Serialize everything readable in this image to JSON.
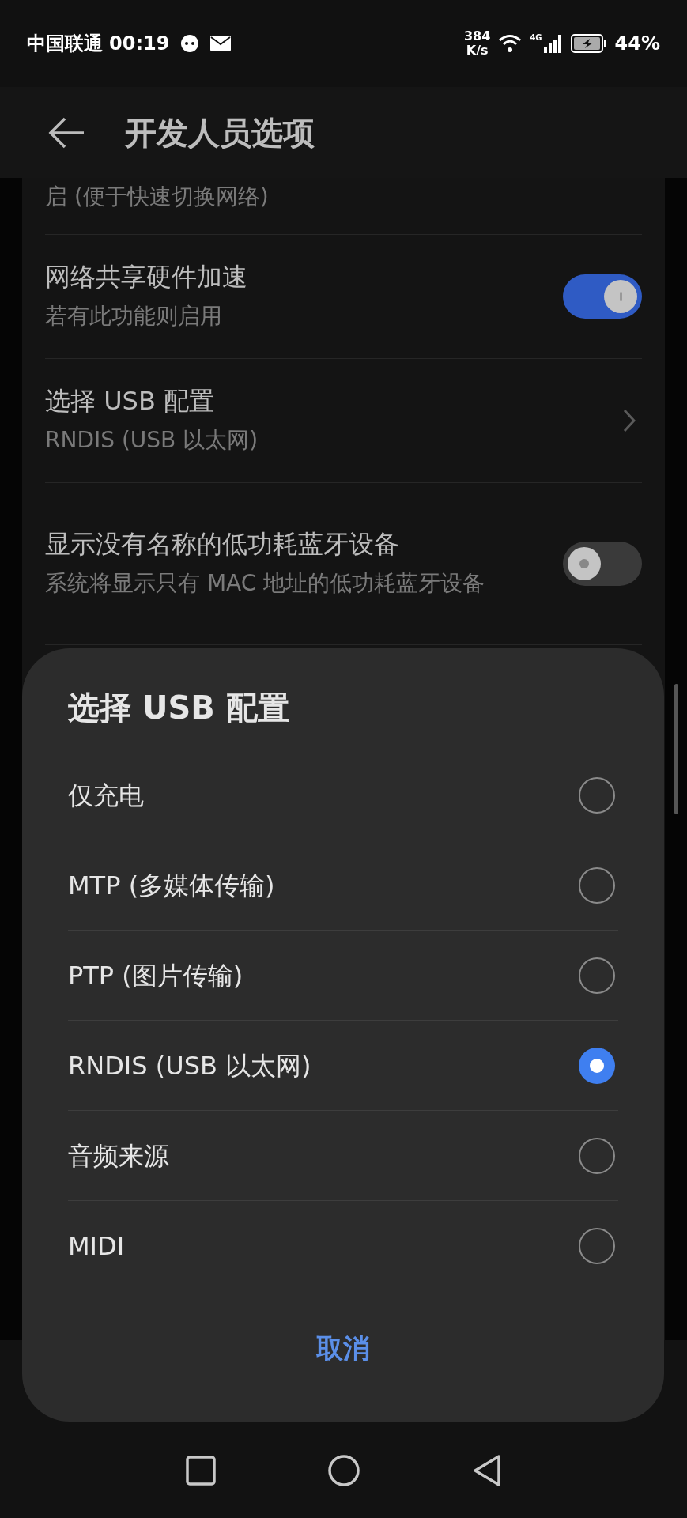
{
  "status_bar": {
    "carrier": "中国联通",
    "time": "00:19",
    "net_speed_value": "384",
    "net_speed_unit": "K/s",
    "network_type": "4G",
    "battery": "44%"
  },
  "header": {
    "title": "开发人员选项"
  },
  "settings": [
    {
      "kind": "text",
      "subtitle": "启 (便于快速切换网络)"
    },
    {
      "kind": "switch",
      "title": "网络共享硬件加速",
      "subtitle": "若有此功能则启用",
      "on": true
    },
    {
      "kind": "link",
      "title": "选择 USB 配置",
      "subtitle": "RNDIS (USB 以太网)"
    },
    {
      "kind": "switch",
      "title": "显示没有名称的低功耗蓝牙设备",
      "subtitle": "系统将显示只有 MAC 地址的低功耗蓝牙设备",
      "on": false
    }
  ],
  "dialog": {
    "title": "选择 USB 配置",
    "options": [
      {
        "label": "仅充电",
        "selected": false
      },
      {
        "label": "MTP (多媒体传输)",
        "selected": false
      },
      {
        "label": "PTP (图片传输)",
        "selected": false
      },
      {
        "label": "RNDIS (USB 以太网)",
        "selected": true
      },
      {
        "label": "音频来源",
        "selected": false
      },
      {
        "label": "MIDI",
        "selected": false
      }
    ],
    "cancel": "取消"
  }
}
